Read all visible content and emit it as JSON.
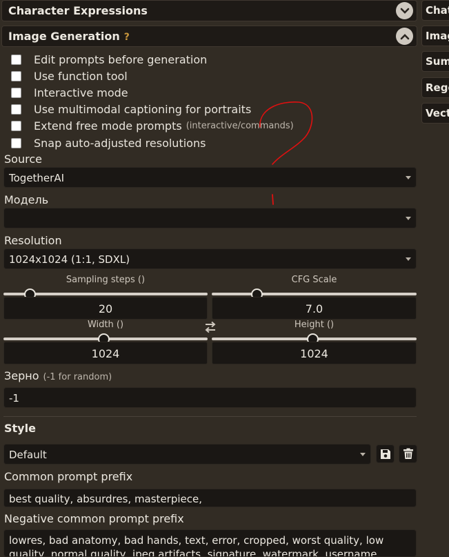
{
  "drawers": {
    "character_expressions": "Character Expressions",
    "image_generation": "Image Generation",
    "help_mark": "?"
  },
  "right_tabs": [
    "Chat",
    "Image",
    "Sum",
    "Rege",
    "Vect"
  ],
  "checkboxes": [
    {
      "label": "Edit prompts before generation",
      "note": ""
    },
    {
      "label": "Use function tool",
      "note": ""
    },
    {
      "label": "Interactive mode",
      "note": ""
    },
    {
      "label": "Use multimodal captioning for portraits",
      "note": ""
    },
    {
      "label": "Extend free mode prompts",
      "note": "(interactive/commands)"
    },
    {
      "label": "Snap auto-adjusted resolutions",
      "note": ""
    }
  ],
  "source": {
    "label": "Source",
    "value": "TogetherAI"
  },
  "model": {
    "label": "Модель",
    "value": ""
  },
  "resolution": {
    "label": "Resolution",
    "value": "1024x1024 (1:1, SDXL)"
  },
  "sampling_steps": {
    "label": "Sampling steps ()",
    "value": "20",
    "fraction": 0.13
  },
  "cfg_scale": {
    "label": "CFG Scale",
    "value": "7.0",
    "fraction": 0.22
  },
  "width": {
    "label": "Width ()",
    "value": "1024",
    "fraction": 0.49
  },
  "height": {
    "label": "Height ()",
    "value": "1024",
    "fraction": 0.49
  },
  "seed": {
    "label": "Зерно",
    "hint": "(-1 for random)",
    "value": "-1"
  },
  "style": {
    "heading": "Style",
    "value": "Default"
  },
  "common_prefix": {
    "label": "Common prompt prefix",
    "value": "best quality, absurdres, masterpiece,"
  },
  "negative_prefix": {
    "label": "Negative common prompt prefix",
    "value": "lowres, bad anatomy, bad hands, text, error, cropped, worst quality, low quality, normal quality, jpeg artifacts, signature, watermark, username, blurry"
  },
  "colors": {
    "background": "#322c24",
    "panel": "#1a1714",
    "accent_help": "#c8963c",
    "annotation": "#e01010"
  },
  "icons": [
    "chevron-down-icon",
    "chevron-up-icon",
    "swap-icon",
    "save-icon",
    "trash-icon"
  ]
}
